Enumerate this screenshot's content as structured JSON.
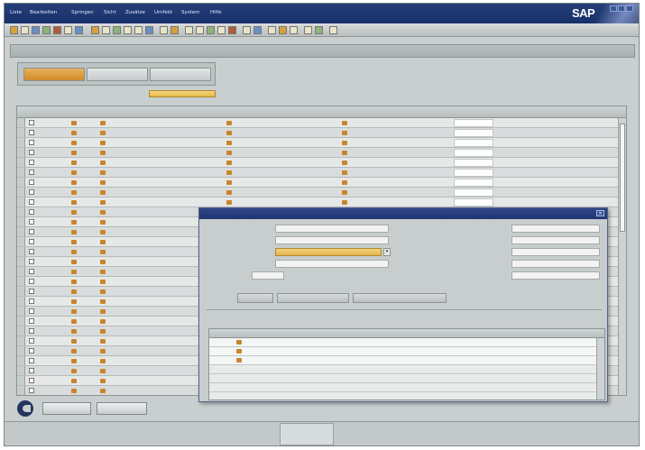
{
  "menubar": {
    "items": [
      "Liste",
      "Bearbeiten",
      "Springen",
      "Sicht",
      "Zusätze",
      "Umfeld",
      "System",
      "Hilfe"
    ],
    "logo_text": "SAP"
  },
  "window": {
    "title": ""
  },
  "tabs": [
    {
      "label": "",
      "active": true
    },
    {
      "label": "",
      "active": false
    },
    {
      "label": "",
      "active": false
    }
  ],
  "filter": {
    "label": "",
    "value": ""
  },
  "grid": {
    "columns": [
      "",
      "",
      "",
      "",
      "",
      "",
      "",
      "",
      "",
      "",
      "",
      "",
      "",
      "",
      ""
    ],
    "rows": [
      {
        "a": "",
        "b": "",
        "c": "",
        "d": "",
        "e": "",
        "f": "",
        "g": "",
        "h": "",
        "i": "",
        "j": "",
        "k": ""
      },
      {
        "a": "",
        "b": "",
        "c": "",
        "d": "",
        "e": "",
        "f": "",
        "g": "",
        "h": "",
        "i": "",
        "j": "",
        "k": ""
      },
      {
        "a": "",
        "b": "",
        "c": "",
        "d": "",
        "e": "",
        "f": "",
        "g": "",
        "h": "",
        "i": "",
        "j": "",
        "k": ""
      },
      {
        "a": "",
        "b": "",
        "c": "",
        "d": "",
        "e": "",
        "f": "",
        "g": "",
        "h": "",
        "i": "",
        "j": "",
        "k": ""
      },
      {
        "a": "",
        "b": "",
        "c": "",
        "d": "",
        "e": "",
        "f": "",
        "g": "",
        "h": "",
        "i": "",
        "j": "",
        "k": ""
      },
      {
        "a": "",
        "b": "",
        "c": "",
        "d": "",
        "e": "",
        "f": "",
        "g": "",
        "h": "",
        "i": "",
        "j": "",
        "k": ""
      },
      {
        "a": "",
        "b": "",
        "c": "",
        "d": "",
        "e": "",
        "f": "",
        "g": "",
        "h": "",
        "i": "",
        "j": "",
        "k": ""
      },
      {
        "a": "",
        "b": "",
        "c": "",
        "d": "",
        "e": "",
        "f": "",
        "g": "",
        "h": "",
        "i": "",
        "j": "",
        "k": ""
      },
      {
        "a": "",
        "b": "",
        "c": "",
        "d": "",
        "e": "",
        "f": "",
        "g": "",
        "h": "",
        "i": "",
        "j": "",
        "k": ""
      },
      {
        "a": "",
        "b": "",
        "c": "",
        "d": "",
        "e": "",
        "f": "",
        "g": "",
        "h": "",
        "i": "",
        "j": "",
        "k": ""
      },
      {
        "a": "",
        "b": "",
        "c": "",
        "d": "",
        "e": "",
        "f": "",
        "g": "",
        "h": "",
        "i": "",
        "j": "",
        "k": ""
      },
      {
        "a": "",
        "b": "",
        "c": "",
        "d": "",
        "e": "",
        "f": "",
        "g": "",
        "h": "",
        "i": "",
        "j": "",
        "k": ""
      },
      {
        "a": "",
        "b": "",
        "c": "",
        "d": "",
        "e": "",
        "f": "",
        "g": "",
        "h": "",
        "i": "",
        "j": "",
        "k": ""
      },
      {
        "a": "",
        "b": "",
        "c": "",
        "d": "",
        "e": "",
        "f": "",
        "g": "",
        "h": "",
        "i": "",
        "j": "",
        "k": ""
      },
      {
        "a": "",
        "b": "",
        "c": "",
        "d": "",
        "e": "",
        "f": "",
        "g": "",
        "h": "",
        "i": "",
        "j": "",
        "k": ""
      },
      {
        "a": "",
        "b": "",
        "c": "",
        "d": "",
        "e": "",
        "f": "",
        "g": "",
        "h": "",
        "i": "",
        "j": "",
        "k": ""
      },
      {
        "a": "",
        "b": "",
        "c": "",
        "d": "",
        "e": "",
        "f": "",
        "g": "",
        "h": "",
        "i": "",
        "j": "",
        "k": ""
      },
      {
        "a": "",
        "b": "",
        "c": "",
        "d": "",
        "e": "",
        "f": "",
        "g": "",
        "h": "",
        "i": "",
        "j": "",
        "k": ""
      },
      {
        "a": "",
        "b": "",
        "c": "",
        "d": "",
        "e": "",
        "f": "",
        "g": "",
        "h": "",
        "i": "",
        "j": "",
        "k": ""
      },
      {
        "a": "",
        "b": "",
        "c": "",
        "d": "",
        "e": "",
        "f": "",
        "g": "",
        "h": "",
        "i": "",
        "j": "",
        "k": ""
      },
      {
        "a": "",
        "b": "",
        "c": "",
        "d": "",
        "e": "",
        "f": "",
        "g": "",
        "h": "",
        "i": "",
        "j": "",
        "k": ""
      },
      {
        "a": "",
        "b": "",
        "c": "",
        "d": "",
        "e": "",
        "f": "",
        "g": "",
        "h": "",
        "i": "",
        "j": "",
        "k": ""
      },
      {
        "a": "",
        "b": "",
        "c": "",
        "d": "",
        "e": "",
        "f": "",
        "g": "",
        "h": "",
        "i": "",
        "j": "",
        "k": ""
      },
      {
        "a": "",
        "b": "",
        "c": "",
        "d": "",
        "e": "",
        "f": "",
        "g": "",
        "h": "",
        "i": "",
        "j": "",
        "k": ""
      },
      {
        "a": "",
        "b": "",
        "c": "",
        "d": "",
        "e": "",
        "f": "",
        "g": "",
        "h": "",
        "i": "",
        "j": "",
        "k": ""
      },
      {
        "a": "",
        "b": "",
        "c": "",
        "d": "",
        "e": "",
        "f": "",
        "g": "",
        "h": "",
        "i": "",
        "j": "",
        "k": ""
      },
      {
        "a": "",
        "b": "",
        "c": "",
        "d": "",
        "e": "",
        "f": "",
        "g": "",
        "h": "",
        "i": "",
        "j": "",
        "k": ""
      },
      {
        "a": "",
        "b": "",
        "c": "",
        "d": "",
        "e": "",
        "f": "",
        "g": "",
        "h": "",
        "i": "",
        "j": "",
        "k": ""
      }
    ]
  },
  "dialog": {
    "title": "",
    "fields_left": [
      {
        "label": "",
        "value": ""
      },
      {
        "label": "",
        "value": ""
      },
      {
        "label": "",
        "value": ""
      },
      {
        "label": "",
        "value": ""
      },
      {
        "label": "",
        "value": ""
      }
    ],
    "fields_right": [
      {
        "label": "",
        "value": ""
      },
      {
        "label": "",
        "value": ""
      },
      {
        "label": "",
        "value": ""
      },
      {
        "label": "",
        "value": ""
      },
      {
        "label": "",
        "value": ""
      }
    ],
    "sliders": [
      "",
      "",
      ""
    ],
    "sub_columns": [
      "",
      "",
      "",
      "",
      "",
      "",
      "",
      "",
      ""
    ],
    "sub_rows": [
      {
        "c1": "",
        "c2": "",
        "c3": "",
        "c4": "",
        "c5": "",
        "c6": "",
        "c7": "",
        "c8": ""
      },
      {
        "c1": "",
        "c2": "",
        "c3": "",
        "c4": "",
        "c5": "",
        "c6": "",
        "c7": "",
        "c8": ""
      },
      {
        "c1": "",
        "c2": "",
        "c3": "",
        "c4": "",
        "c5": "",
        "c6": "",
        "c7": "",
        "c8": ""
      }
    ]
  },
  "footer": {
    "ok_label": "",
    "cancel_label": ""
  },
  "status": {
    "text": "",
    "detail": "",
    "center_line1": "",
    "center_line2": ""
  },
  "colors": {
    "menubar": "#1f356f",
    "accent_orange": "#d18a2a",
    "yellow_field": "#e5b846",
    "background": "#c9cfcf"
  }
}
